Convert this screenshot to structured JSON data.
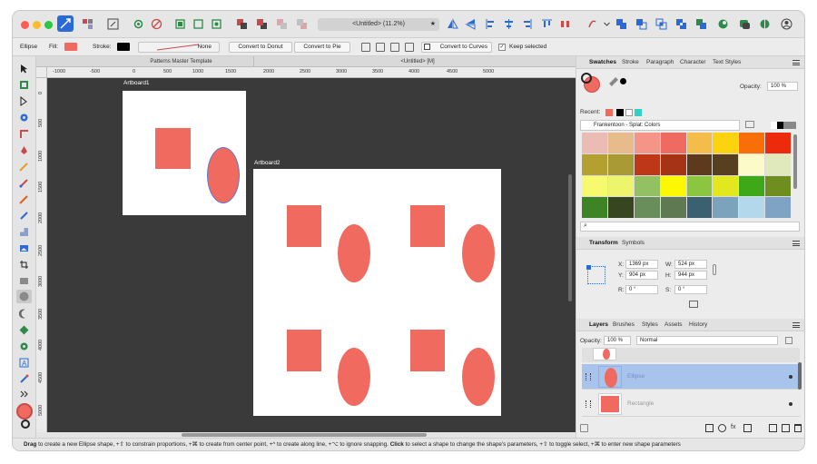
{
  "window": {
    "document_title": "<Untitled> (11.2%)",
    "star": "★"
  },
  "context_bar": {
    "shape_name": "Ellipse",
    "fill_label": "Fill:",
    "fill_color": "#f06a5f",
    "stroke_label": "Stroke:",
    "stroke_color": "#000000",
    "stroke_style": "None",
    "convert_donut": "Convert to Donut",
    "convert_pie": "Convert to Pie",
    "convert_curves": "Convert to Curves",
    "keep_selected": "Keep selected"
  },
  "document_tabs": [
    "Patterns Master Template",
    "<Untitled> [M]"
  ],
  "ruler": {
    "horizontal": [
      "-1000",
      "-500",
      "0",
      "500",
      "1000",
      "1500",
      "2000",
      "2500",
      "3000",
      "3500",
      "4000",
      "4500",
      "5000"
    ],
    "vertical": [
      "0",
      "500",
      "1000",
      "1500",
      "2000",
      "2500",
      "3000",
      "3500",
      "4000",
      "4500",
      "5000",
      "5500",
      "6000"
    ]
  },
  "artboards": {
    "one": "Artboard1",
    "two": "Artboard2"
  },
  "swatches_panel": {
    "tabs": [
      "Swatches",
      "Stroke",
      "Paragraph",
      "Character",
      "Text Styles"
    ],
    "opacity_label": "Opacity:",
    "opacity_value": "100 %",
    "recent_label": "Recent:",
    "palette_name": "Frankentoon - Splat: Colors",
    "colors": [
      "#ebbcb3",
      "#e8bb8c",
      "#f5958a",
      "#ef6b61",
      "#f4bc49",
      "#fbd30e",
      "#f86f0a",
      "#ec2b0c",
      "#b3a031",
      "#a99a35",
      "#be3818",
      "#a53417",
      "#5e3a1c",
      "#57401f",
      "#fcfac8",
      "#dfe9bc",
      "#f7fa6f",
      "#ecf56b",
      "#92c063",
      "#fcf703",
      "#8cc53f",
      "#e2e71e",
      "#3ea818",
      "#6f8e20",
      "#3e8424",
      "#384521",
      "#6a8d5c",
      "#5f7a53",
      "#3b6070",
      "#7ba3bc",
      "#b3d8ec",
      "#7fa3c4"
    ]
  },
  "transform_panel": {
    "tabs": [
      "Transform",
      "Symbols"
    ],
    "x_label": "X:",
    "x_value": "1369 px",
    "y_label": "Y:",
    "y_value": "904 px",
    "w_label": "W:",
    "w_value": "524 px",
    "h_label": "H:",
    "h_value": "944 px",
    "r_label": "R:",
    "r_value": "0 °",
    "s_label": "S:",
    "s_value": "0 °"
  },
  "layers_panel": {
    "tabs": [
      "Layers",
      "Brushes",
      "Styles",
      "Assets",
      "History"
    ],
    "opacity_label": "Opacity:",
    "opacity_value": "100 %",
    "blend_mode": "Normal",
    "layers": [
      "Ellipse",
      "Rectangle"
    ]
  },
  "status_bar": {
    "drag": "Drag",
    "drag_text": " to create a new Ellipse shape, +⇧ to constrain proportions, +⌘ to create from center point, +^ to create along line, +⌥ to ignore snapping. ",
    "click": "Click",
    "click_text": " to select a shape to change the shape's parameters, +⇧ to toggle select, +⌘ to enter new shape parameters"
  }
}
